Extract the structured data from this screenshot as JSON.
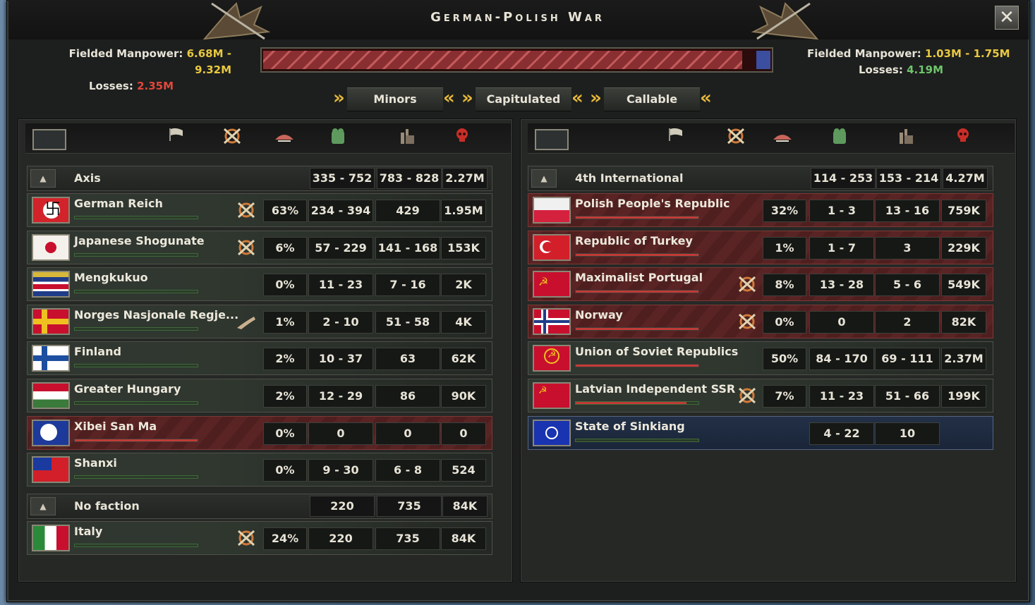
{
  "window": {
    "title": "German-Polish War",
    "close_label": "✕"
  },
  "left_stats": {
    "manpower_label": "Fielded Manpower:",
    "manpower_value": "6.68M - 9.32M",
    "losses_label": "Losses:",
    "losses_value": "2.35M"
  },
  "right_stats": {
    "manpower_label": "Fielded Manpower:",
    "manpower_value": "1.03M - 1.75M",
    "losses_label": "Losses:",
    "losses_value": "4.19M"
  },
  "war_progress": {
    "attacker_share": 0.97,
    "attacker_color": "#b84a4c",
    "defender_color": "#3b4ea0"
  },
  "tabs": [
    {
      "label": "Minors"
    },
    {
      "label": "Capitulated"
    },
    {
      "label": "Callable"
    }
  ],
  "header_icons": [
    "flag-icon",
    "crossed-swords-icon",
    "plane-icon",
    "manpower-icon",
    "factory-icon",
    "skull-icon"
  ],
  "left": {
    "factions": [
      {
        "name": "Axis",
        "c1": "335 - 752",
        "c2": "783 - 828",
        "c3": "2.27M",
        "countries": [
          {
            "name": "German Reich",
            "flag": "flag-german-reich",
            "style": "g",
            "icon": "crossed-swords-icon",
            "pct": "63%",
            "c1": "234 - 394",
            "c2": "429",
            "c3": "1.95M",
            "bar": 0.0,
            "bar_color": "#4e8a46"
          },
          {
            "name": "Japanese Shogunate",
            "flag": "flag-japan",
            "style": "g",
            "icon": "crossed-swords-icon",
            "pct": "6%",
            "c1": "57 - 229",
            "c2": "141 - 168",
            "c3": "153K",
            "bar": 0.0,
            "bar_color": "#4e8a46"
          },
          {
            "name": "Mengkukuo",
            "flag": "flag-mengkukuo",
            "style": "g",
            "icon": "",
            "pct": "0%",
            "c1": "11 - 23",
            "c2": "7 - 16",
            "c3": "2K",
            "bar": 0.0,
            "bar_color": "#4e8a46"
          },
          {
            "name": "Norges Nasjonale Regje...",
            "flag": "flag-norway-national",
            "style": "g",
            "icon": "support-hand-icon",
            "pct": "1%",
            "c1": "2 - 10",
            "c2": "51 - 58",
            "c3": "4K",
            "bar": 0.0,
            "bar_color": "#4e8a46"
          },
          {
            "name": "Finland",
            "flag": "flag-finland",
            "style": "g",
            "icon": "",
            "pct": "2%",
            "c1": "10 - 37",
            "c2": "63",
            "c3": "62K",
            "bar": 0.0,
            "bar_color": "#4e8a46"
          },
          {
            "name": "Greater Hungary",
            "flag": "flag-hungary",
            "style": "g",
            "icon": "",
            "pct": "2%",
            "c1": "12 - 29",
            "c2": "86",
            "c3": "90K",
            "bar": 0.0,
            "bar_color": "#4e8a46"
          },
          {
            "name": "Xibei San Ma",
            "flag": "flag-xibei",
            "style": "r",
            "icon": "",
            "pct": "0%",
            "c1": "0",
            "c2": "0",
            "c3": "0",
            "bar": 1.0,
            "bar_color": "#c23a36"
          },
          {
            "name": "Shanxi",
            "flag": "flag-shanxi",
            "style": "g",
            "icon": "",
            "pct": "0%",
            "c1": "9 - 30",
            "c2": "6 - 8",
            "c3": "524",
            "bar": 0.0,
            "bar_color": "#4e8a46"
          }
        ]
      },
      {
        "name": "No faction",
        "c1": "220",
        "c2": "735",
        "c3": "84K",
        "countries": [
          {
            "name": "Italy",
            "flag": "flag-italy",
            "style": "g",
            "icon": "crossed-swords-icon",
            "pct": "24%",
            "c1": "220",
            "c2": "735",
            "c3": "84K",
            "bar": 0.0,
            "bar_color": "#4e8a46"
          }
        ]
      }
    ]
  },
  "right": {
    "factions": [
      {
        "name": "4th International",
        "c1": "114 - 253",
        "c2": "153 - 214",
        "c3": "4.27M",
        "countries": [
          {
            "name": "Polish People's Republic",
            "flag": "flag-poland",
            "style": "r",
            "icon": "",
            "pct": "32%",
            "c1": "1 - 3",
            "c2": "13 - 16",
            "c3": "759K",
            "bar": 1.0,
            "bar_color": "#c23a36"
          },
          {
            "name": "Republic of Turkey",
            "flag": "flag-turkey",
            "style": "r",
            "icon": "",
            "pct": "1%",
            "c1": "1 - 7",
            "c2": "3",
            "c3": "229K",
            "bar": 1.0,
            "bar_color": "#c23a36"
          },
          {
            "name": "Maximalist Portugal",
            "flag": "flag-portugal",
            "style": "r",
            "icon": "crossed-swords-icon",
            "pct": "8%",
            "c1": "13 - 28",
            "c2": "5 - 6",
            "c3": "549K",
            "bar": 1.0,
            "bar_color": "#c23a36"
          },
          {
            "name": "Norway",
            "flag": "flag-norway",
            "style": "r",
            "icon": "crossed-swords-icon",
            "pct": "0%",
            "c1": "0",
            "c2": "2",
            "c3": "82K",
            "bar": 1.0,
            "bar_color": "#c23a36"
          },
          {
            "name": "Union of Soviet Republics",
            "flag": "flag-soviet",
            "style": "g",
            "icon": "",
            "pct": "50%",
            "c1": "84 - 170",
            "c2": "69 - 111",
            "c3": "2.37M",
            "bar": 1.0,
            "bar_color": "#c23a36"
          },
          {
            "name": "Latvian Independent SSR",
            "flag": "flag-latvian-ssr",
            "style": "g",
            "icon": "crossed-swords-icon",
            "pct": "7%",
            "c1": "11 - 23",
            "c2": "51 - 66",
            "c3": "199K",
            "bar": 0.9,
            "bar_color": "#c23a36"
          },
          {
            "name": "State of Sinkiang",
            "flag": "flag-sinkiang",
            "style": "b",
            "icon": "",
            "pct": "",
            "c1": "4 - 22",
            "c2": "10",
            "c3": "",
            "bar": 0.0,
            "bar_color": "#4e8a46"
          }
        ]
      }
    ]
  }
}
